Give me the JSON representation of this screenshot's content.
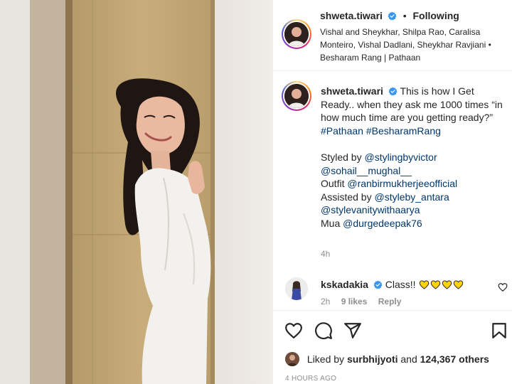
{
  "post": {
    "username": "shweta.tiwari",
    "follow_status": "Following",
    "separator": "•",
    "audio": "Vishal and Sheykhar, Shilpa Rao, Caralisa Monteiro, Vishal Dadlani, Sheykhar Ravjiani • Besharam Rang | Pathaan",
    "caption": {
      "text_1": "This is how I Get Ready.. when they ask me 1000 times “in how much time are you getting ready?”",
      "hashtags": "#Pathaan #BesharamRang",
      "styled_prefix": "Styled by",
      "styled_tag_1": "@stylingbyvictor",
      "styled_tag_2": "@sohail__mughal__",
      "outfit_prefix": "Outfit",
      "outfit_tag": "@ranbirmukherjeeofficial",
      "assisted_prefix": "Assisted by",
      "assisted_tag_1": "@styleby_antara",
      "assisted_tag_2": "@stylevanitywithaarya",
      "mua_prefix": "Mua",
      "mua_tag": "@durgedeepak76"
    },
    "caption_time": "4h"
  },
  "comment": {
    "username": "kskadakia",
    "text": "Class!!",
    "emoji": "yellow-heart",
    "emoji_count": 4,
    "time": "2h",
    "likes": "9 likes",
    "reply": "Reply"
  },
  "likes": {
    "prefix": "Liked by",
    "user": "surbhijyoti",
    "and": "and",
    "count": "124,367 others"
  },
  "posted_ago": "4 HOURS AGO",
  "colors": {
    "verified": "#3897f0",
    "link": "#00376b",
    "muted": "#8e8e8e",
    "heart_emoji": "#ffd400"
  },
  "icons": [
    "verified-badge-icon",
    "heart-icon",
    "comment-icon",
    "share-icon",
    "bookmark-icon",
    "like-comment-icon",
    "yellow-heart-icon"
  ]
}
